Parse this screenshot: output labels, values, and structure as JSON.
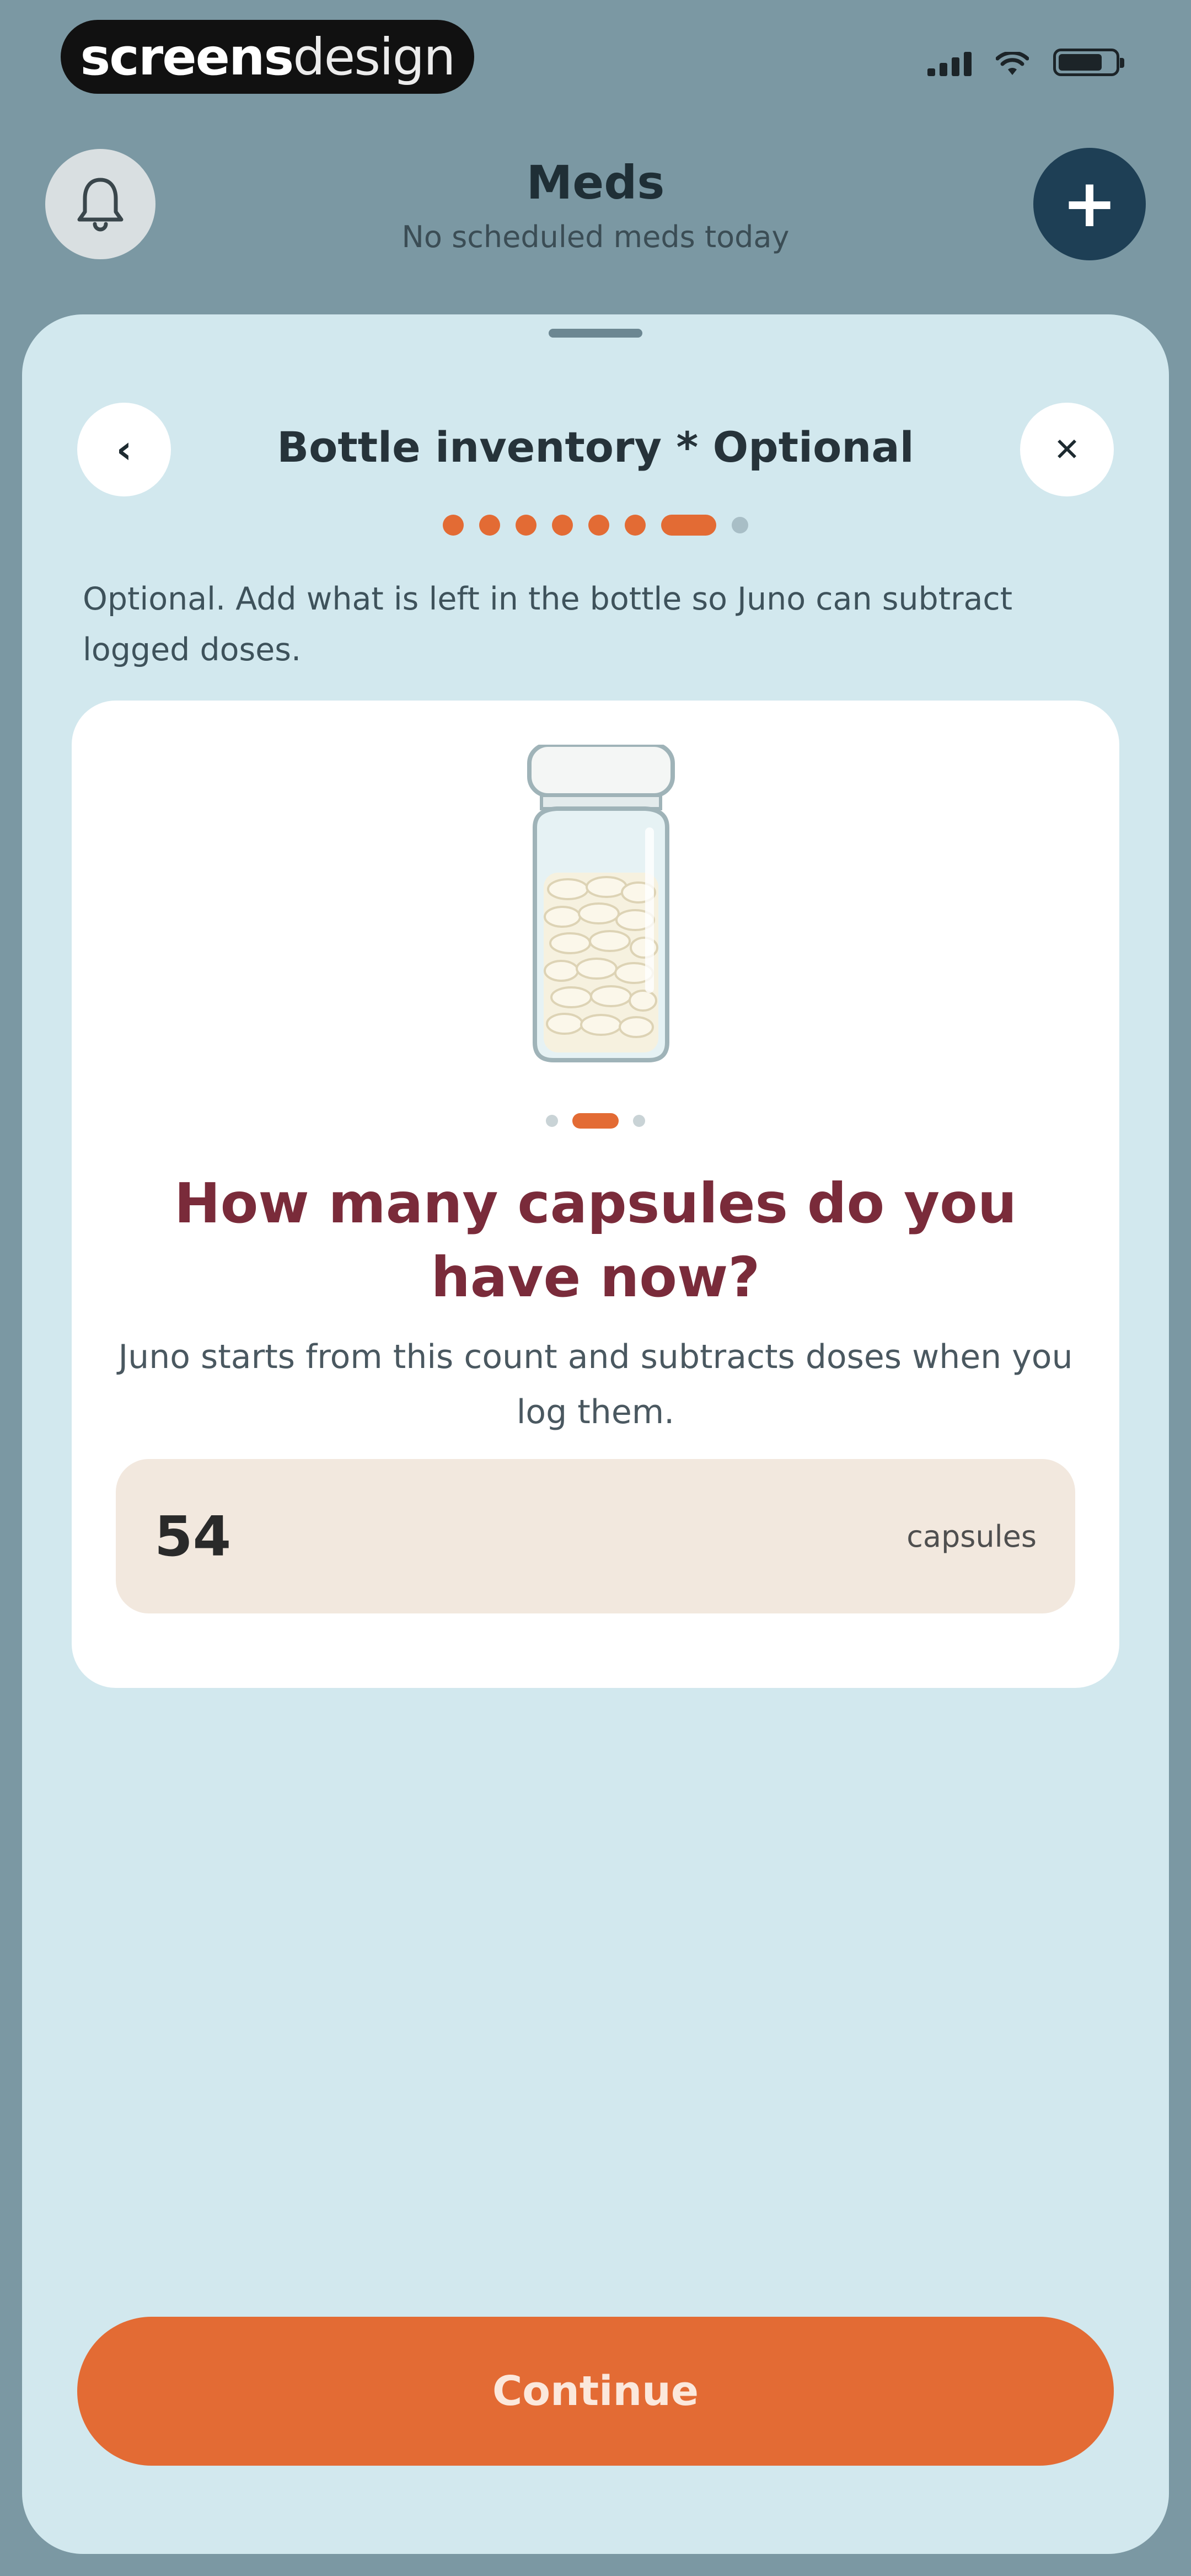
{
  "status_bar": {
    "brand_part1": "screens",
    "brand_part2": "design"
  },
  "header": {
    "title": "Meds",
    "subtitle": "No scheduled meds today",
    "add_label": "+"
  },
  "sheet": {
    "back_label": "‹",
    "close_label": "✕",
    "title": "Bottle inventory * Optional",
    "description": "Optional. Add what is left in the bottle so Juno can subtract logged doses.",
    "progress": {
      "completed_steps": 6,
      "current_step": 7,
      "total_steps": 8
    }
  },
  "card": {
    "carousel": {
      "active_index": 1,
      "count": 3
    },
    "question": "How many capsules do you have now?",
    "help": "Juno starts from this count and subtracts doses when you log them.",
    "count_value": "54",
    "count_unit": "capsules"
  },
  "actions": {
    "continue_label": "Continue"
  },
  "colors": {
    "accent": "#e36b34",
    "sheet_bg": "#d2e8ee",
    "header_bg": "#7b98a3",
    "question_color": "#7a2b3a",
    "add_button_bg": "#1e3f55"
  },
  "icons": {
    "bell": "bell-icon",
    "add": "plus-icon",
    "back": "chevron-left-icon",
    "close": "close-icon",
    "illustration": "pill-bottle-illustration"
  }
}
